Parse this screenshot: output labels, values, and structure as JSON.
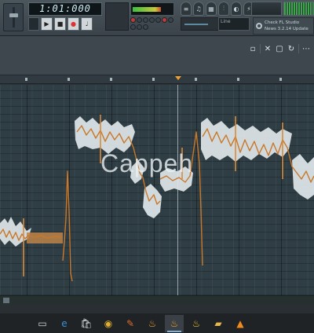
{
  "toolbar": {
    "time_display": "1:01:000",
    "cpu_label": "Line",
    "news_text": "Check FL Studio News 3.2.14 Update"
  },
  "transport": {
    "play_icon": "play-icon",
    "stop_icon": "stop-icon",
    "record_icon": "record-icon"
  },
  "editor": {
    "watermark": "Cappeh"
  },
  "taskbar": {
    "apps": [
      "task-view-icon",
      "edge-icon",
      "store-icon",
      "chrome-icon",
      "sketch-icon",
      "fl-studio-icon",
      "fl-studio-icon-2",
      "fl-studio-icon-3",
      "files-icon",
      "vlc-icon"
    ]
  },
  "colors": {
    "note_fill": "#dfe7eb",
    "pitch_line": "#c9782a",
    "playhead": "#f0a030",
    "background": "#2f3e44"
  }
}
